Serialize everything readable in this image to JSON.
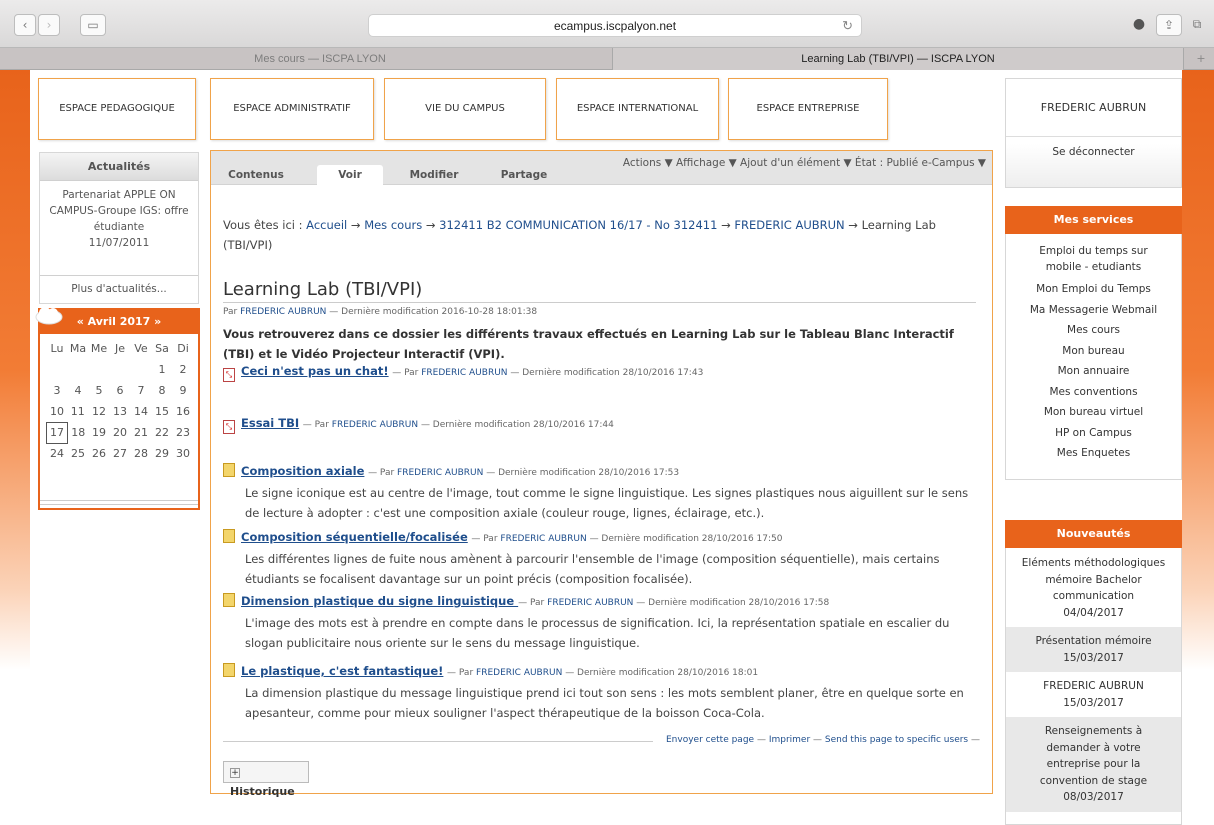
{
  "browser": {
    "url": "ecampus.iscpalyon.net",
    "tabs": [
      {
        "label": "Mes cours — ISCPA LYON"
      },
      {
        "label": "Learning Lab (TBI/VPI) — ISCPA LYON"
      }
    ]
  },
  "nav": {
    "items": [
      {
        "label": "ESPACE PEDAGOGIQUE"
      },
      {
        "label": "ESPACE ADMINISTRATIF"
      },
      {
        "label": "VIE DU CAMPUS"
      },
      {
        "label": "ESPACE INTERNATIONAL"
      },
      {
        "label": "ESPACE ENTREPRISE"
      }
    ]
  },
  "news": {
    "title": "Actualités",
    "item_text": "Partenariat APPLE ON CAMPUS-Groupe IGS: offre étudiante",
    "item_date": "11/07/2011",
    "more": "Plus d'actualités..."
  },
  "calendar": {
    "title": "« Avril 2017 »",
    "weekdays": [
      "Lu",
      "Ma",
      "Me",
      "Je",
      "Ve",
      "Sa",
      "Di"
    ],
    "rows": [
      [
        "",
        "",
        "",
        "",
        "",
        "1",
        "2"
      ],
      [
        "3",
        "4",
        "5",
        "6",
        "7",
        "8",
        "9"
      ],
      [
        "10",
        "11",
        "12",
        "13",
        "14",
        "15",
        "16"
      ],
      [
        "17",
        "18",
        "19",
        "20",
        "21",
        "22",
        "23"
      ],
      [
        "24",
        "25",
        "26",
        "27",
        "28",
        "29",
        "30"
      ]
    ],
    "today": "17"
  },
  "content_tabs": [
    "Contenus",
    "Voir",
    "Modifier",
    "Partage"
  ],
  "actions_bar": "Actions ▼   Affichage ▼   Ajout d'un élément ▼   État : Publié e-Campus ▼",
  "breadcrumb": {
    "prefix": "Vous êtes ici :",
    "sep": "→",
    "items": [
      "Accueil",
      "Mes cours",
      "312411 B2 COMMUNICATION 16/17 - No 312411",
      "FREDERIC AUBRUN",
      "Learning Lab (TBI/VPI)"
    ]
  },
  "document": {
    "title": "Learning Lab (TBI/VPI)",
    "by_prefix": "Par",
    "author": "FREDERIC AUBRUN",
    "modified": "— Dernière modification 2016-10-28 18:01:38",
    "intro": "Vous retrouverez dans ce dossier les différents travaux effectués en Learning Lab sur le Tableau Blanc Interactif (TBI) et le Vidéo Projecteur Interactif (VPI)."
  },
  "items": [
    {
      "title": "Ceci n'est pas un chat!",
      "icon": "pdf-icon",
      "meta_pre": "— Par",
      "author": "FREDERIC AUBRUN",
      "meta_post": "— Dernière modification 28/10/2016 17:43",
      "desc": ""
    },
    {
      "title": "Essai TBI",
      "icon": "pdf-icon",
      "meta_pre": "— Par",
      "author": "FREDERIC AUBRUN",
      "meta_post": "— Dernière modification 28/10/2016 17:44",
      "desc": ""
    },
    {
      "title": "Composition axiale",
      "icon": "document-icon",
      "meta_pre": "— Par",
      "author": "FREDERIC AUBRUN",
      "meta_post": "— Dernière modification 28/10/2016 17:53",
      "desc": "Le signe iconique est au centre de l'image, tout comme le signe linguistique. Les signes plastiques nous aiguillent sur le sens de lecture à adopter : c'est une composition axiale (couleur rouge, lignes, éclairage, etc.)."
    },
    {
      "title": "Composition séquentielle/focalisée",
      "icon": "document-icon",
      "meta_pre": "— Par",
      "author": "FREDERIC AUBRUN",
      "meta_post": "— Dernière modification 28/10/2016 17:50",
      "desc": "Les différentes lignes de fuite nous amènent à parcourir l'ensemble de l'image (composition séquentielle), mais certains étudiants se focalisent davantage sur un point précis (composition focalisée)."
    },
    {
      "title": "Dimension plastique du signe linguistique ",
      "icon": "document-icon",
      "meta_pre": "— Par",
      "author": "FREDERIC AUBRUN",
      "meta_post": "— Dernière modification 28/10/2016 17:58",
      "desc": "L'image des mots est à prendre en compte dans le processus de signification. Ici, la représentation spatiale en escalier du slogan publicitaire nous oriente sur le sens du message linguistique."
    },
    {
      "title": "Le plastique, c'est fantastique!",
      "icon": "document-icon",
      "meta_pre": "— Par",
      "author": "FREDERIC AUBRUN",
      "meta_post": "— Dernière modification 28/10/2016 18:01",
      "desc": "La dimension plastique du message linguistique prend ici tout son sens : les mots semblent planer, être en quelque sorte en apesanteur, comme pour mieux souligner l'aspect thérapeutique de la boisson Coca-Cola."
    }
  ],
  "footer": {
    "send": "Envoyer cette page",
    "print": "Imprimer",
    "send_users": "Send this page to specific users",
    "history": "Historique"
  },
  "user": {
    "name": "FREDERIC AUBRUN",
    "logout": "Se déconnecter"
  },
  "services": {
    "title": "Mes services",
    "items": [
      "Emploi du temps sur mobile - etudiants",
      "Mon Emploi du Temps",
      "Ma Messagerie Webmail",
      "Mes cours",
      "Mon bureau",
      "Mon annuaire",
      "Mes conventions",
      "Mon bureau virtuel",
      "HP on Campus",
      "Mes Enquetes"
    ]
  },
  "nouveautes": {
    "title": "Nouveautés",
    "items": [
      {
        "text": "Eléments méthodologiques mémoire Bachelor communication",
        "date": "04/04/2017"
      },
      {
        "text": "Présentation mémoire",
        "date": "15/03/2017"
      },
      {
        "text": "FREDERIC AUBRUN",
        "date": "15/03/2017"
      },
      {
        "text": "Renseignements à demander à votre entreprise pour la convention de stage",
        "date": "08/03/2017"
      }
    ]
  },
  "colors": {
    "accent": "#e8631b",
    "nav_border": "#f0a34a",
    "link": "#1f4e8c"
  }
}
